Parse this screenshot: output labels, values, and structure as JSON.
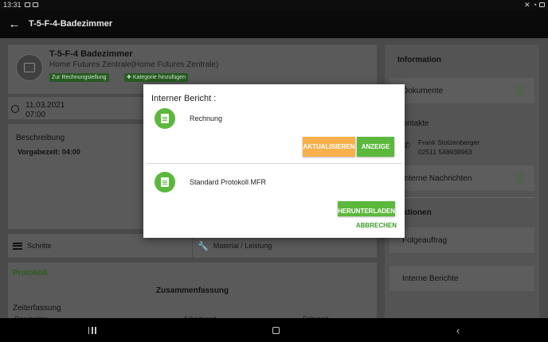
{
  "status_bar": {
    "time": "13:31"
  },
  "app_bar": {
    "title": "T-5-F-4-Badezimmer"
  },
  "header_card": {
    "title": "T-5-F-4 Badezimmer",
    "subtitle": "Home Futures Zentrale(Home Futures Zentrale)",
    "tag_billing": "Zur Rechnungstellung",
    "tag_add_category": "Kategorie hinzufügen"
  },
  "date_card": {
    "date": "11.03.2021",
    "time": "07:00"
  },
  "description_card": {
    "label": "Beschreibung",
    "preset_time": "Vorgabezeit: 04:00"
  },
  "tabs": {
    "steps": "Schritte",
    "material": "Material / Leistung"
  },
  "protocol": {
    "title": "Protokoll",
    "summary": "Zusammenfassung",
    "time_tracking": "Zeiterfassung",
    "columns": [
      "Bearbeiter",
      "Arbeitszeit",
      "Fahrzeit"
    ]
  },
  "sidebar": {
    "info_heading": "Information",
    "documents": "Dokumente",
    "documents_count": "0",
    "contacts": "Kontakte",
    "contact_name": "Frank Stolzenberger",
    "contact_phone": "02511 548938963",
    "messages": "Interne Nachrichten",
    "messages_count": "0",
    "actions_heading": "Aktionen",
    "follow_up": "Folgeauftrag",
    "internal_reports": "Interne Berichte"
  },
  "dialog": {
    "title": "Interner Bericht :",
    "doc1": {
      "label": "Rechnung",
      "update_label": "AKTUALISIEREN",
      "view_label": "ANZEIGE"
    },
    "doc2": {
      "label": "Standard Protokoll MFR",
      "download_label": "HERUNTERLADEN"
    },
    "cancel_label": "ABBRECHEN"
  },
  "colors": {
    "accent_green": "#5bb83c",
    "accent_orange": "#f7b04b"
  }
}
